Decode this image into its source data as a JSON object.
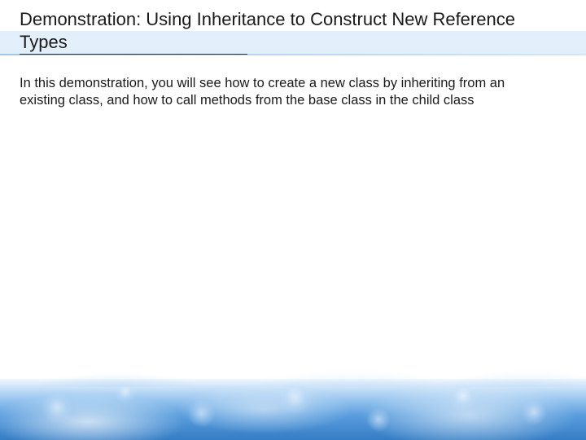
{
  "slide": {
    "title": "Demonstration: Using Inheritance to Construct New Reference Types",
    "body": "In this demonstration, you will see how to create a new class by inheriting from an existing class, and how to call methods from the base class in the child class"
  }
}
